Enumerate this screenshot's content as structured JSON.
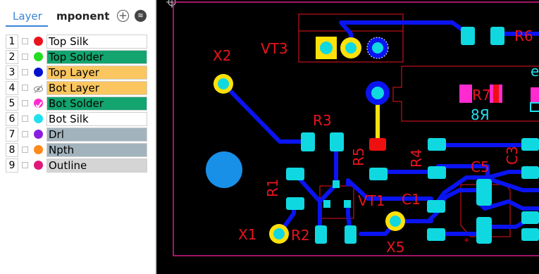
{
  "tabs": [
    {
      "label": "Layer"
    },
    {
      "label": "mponent"
    }
  ],
  "panel_icons": [
    "add-circle-icon",
    "layers-icon"
  ],
  "layers": [
    {
      "num": "1",
      "name": "Top Silk",
      "dot": "#e8141e",
      "bg": "#ffffff",
      "mark": ""
    },
    {
      "num": "2",
      "name": "Top Solder",
      "dot": "#22dd22",
      "bg": "#13a46f",
      "mark": ""
    },
    {
      "num": "3",
      "name": "Top Layer",
      "dot": "#0010d0",
      "bg": "#fbc65f",
      "mark": ""
    },
    {
      "num": "4",
      "name": "Bot Layer",
      "dot": "#ffffff",
      "bg": "#fbc65f",
      "mark": "hidden-eye"
    },
    {
      "num": "5",
      "name": "Bot Solder",
      "dot": "#ff2ad0",
      "bg": "#13a46f",
      "mark": "check"
    },
    {
      "num": "6",
      "name": "Bot Silk",
      "dot": "#20e0ee",
      "bg": "#ffffff",
      "mark": ""
    },
    {
      "num": "7",
      "name": "Drl",
      "dot": "#8a1ee0",
      "bg": "#a2b3bd",
      "mark": ""
    },
    {
      "num": "8",
      "name": "Npth",
      "dot": "#ff8a1a",
      "bg": "#a2b3bd",
      "mark": ""
    },
    {
      "num": "9",
      "name": "Outline",
      "dot": "#e0187a",
      "bg": "#d5d5d5",
      "mark": ""
    }
  ],
  "pcb": {
    "colors": {
      "background": "#000000",
      "track": "#0a14f0",
      "pad": "#10d8e0",
      "silk": "#e8141e",
      "outline": "#d81e8a",
      "via": "#ffe10a",
      "bot_silk": "#20e0ee",
      "pad_red": "#ee1010",
      "bot_solder": "#ff2ad0",
      "npth": "#1890e8"
    },
    "labels": {
      "VT3": "VT3",
      "R6": "R6",
      "X2": "X2",
      "R7": "R7",
      "R8_mirror": "8Я",
      "R3": "R3",
      "R5": "R5",
      "R4": "R4",
      "C3": "C3",
      "C5": "C5",
      "R1": "R1",
      "VT1": "VT1",
      "C1": "C1",
      "X1": "X1",
      "R2": "R2",
      "X5": "X5"
    }
  }
}
